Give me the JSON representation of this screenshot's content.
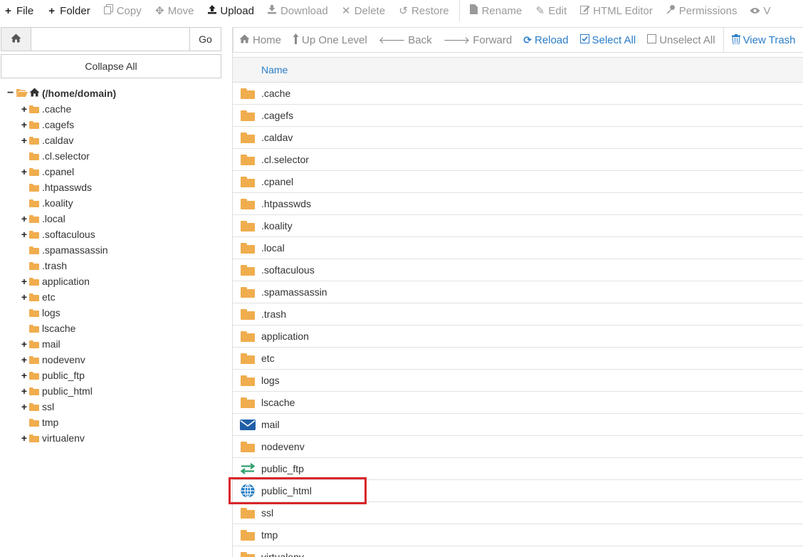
{
  "toolbar": {
    "file": "File",
    "folder": "Folder",
    "copy": "Copy",
    "move": "Move",
    "upload": "Upload",
    "download": "Download",
    "delete": "Delete",
    "restore": "Restore",
    "rename": "Rename",
    "edit": "Edit",
    "html_editor": "HTML Editor",
    "permissions": "Permissions",
    "view_partial": "V"
  },
  "left": {
    "path_value": "",
    "go_label": "Go",
    "collapse_label": "Collapse All",
    "root_label": "(/home/domain)",
    "tree": [
      {
        "label": ".cache",
        "expandable": true
      },
      {
        "label": ".cagefs",
        "expandable": true
      },
      {
        "label": ".caldav",
        "expandable": true
      },
      {
        "label": ".cl.selector",
        "expandable": false
      },
      {
        "label": ".cpanel",
        "expandable": true
      },
      {
        "label": ".htpasswds",
        "expandable": false
      },
      {
        "label": ".koality",
        "expandable": false
      },
      {
        "label": ".local",
        "expandable": true
      },
      {
        "label": ".softaculous",
        "expandable": true
      },
      {
        "label": ".spamassassin",
        "expandable": false
      },
      {
        "label": ".trash",
        "expandable": false
      },
      {
        "label": "application",
        "expandable": true
      },
      {
        "label": "etc",
        "expandable": true
      },
      {
        "label": "logs",
        "expandable": false
      },
      {
        "label": "lscache",
        "expandable": false
      },
      {
        "label": "mail",
        "expandable": true
      },
      {
        "label": "nodevenv",
        "expandable": true
      },
      {
        "label": "public_ftp",
        "expandable": true
      },
      {
        "label": "public_html",
        "expandable": true
      },
      {
        "label": "ssl",
        "expandable": true
      },
      {
        "label": "tmp",
        "expandable": false
      },
      {
        "label": "virtualenv",
        "expandable": true
      }
    ]
  },
  "nav": {
    "home": "Home",
    "up_one_level": "Up One Level",
    "back": "Back",
    "forward": "Forward",
    "reload": "Reload",
    "select_all": "Select All",
    "unselect_all": "Unselect All",
    "view_trash": "View Trash"
  },
  "table": {
    "header_name": "Name",
    "rows": [
      {
        "name": ".cache",
        "icon": "folder-icon"
      },
      {
        "name": ".cagefs",
        "icon": "folder-icon"
      },
      {
        "name": ".caldav",
        "icon": "folder-icon"
      },
      {
        "name": ".cl.selector",
        "icon": "folder-icon"
      },
      {
        "name": ".cpanel",
        "icon": "folder-icon"
      },
      {
        "name": ".htpasswds",
        "icon": "folder-icon"
      },
      {
        "name": ".koality",
        "icon": "folder-icon"
      },
      {
        "name": ".local",
        "icon": "folder-icon"
      },
      {
        "name": ".softaculous",
        "icon": "folder-icon"
      },
      {
        "name": ".spamassassin",
        "icon": "folder-icon"
      },
      {
        "name": ".trash",
        "icon": "folder-icon"
      },
      {
        "name": "application",
        "icon": "folder-icon"
      },
      {
        "name": "etc",
        "icon": "folder-icon"
      },
      {
        "name": "logs",
        "icon": "folder-icon"
      },
      {
        "name": "lscache",
        "icon": "folder-icon"
      },
      {
        "name": "mail",
        "icon": "envelope-icon"
      },
      {
        "name": "nodevenv",
        "icon": "folder-icon"
      },
      {
        "name": "public_ftp",
        "icon": "transfer-arrows-icon"
      },
      {
        "name": "public_html",
        "icon": "globe-icon"
      },
      {
        "name": "ssl",
        "icon": "folder-icon"
      },
      {
        "name": "tmp",
        "icon": "folder-icon"
      },
      {
        "name": "virtualenv",
        "icon": "folder-icon"
      }
    ]
  },
  "colors": {
    "folder": "#f0ad4e",
    "link_blue": "#2a7dc9",
    "highlight_red": "#d9262a",
    "envelope_blue": "#1f5fa8",
    "transfer_green": "#2e9e6b",
    "globe_blue": "#1f7bc4"
  }
}
